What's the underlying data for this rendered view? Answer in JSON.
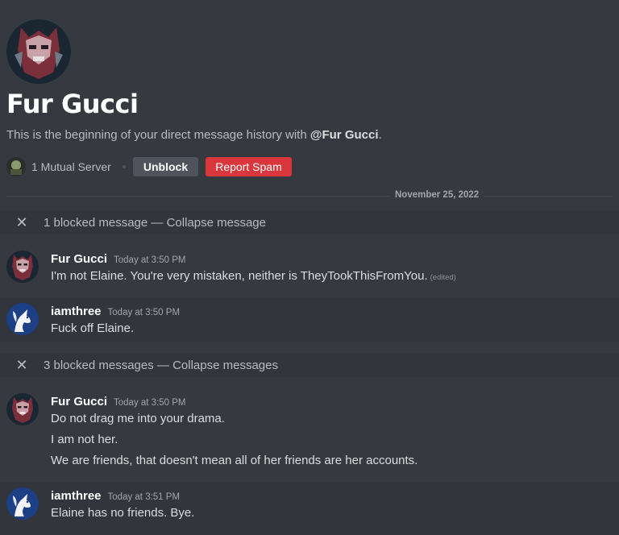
{
  "header": {
    "title": "Fur Gucci",
    "intro_prefix": "This is the beginning of your direct message history with ",
    "intro_mention": "@Fur Gucci",
    "intro_suffix": ".",
    "mutual_servers": "1 Mutual Server",
    "unblock_label": "Unblock",
    "report_spam_label": "Report Spam"
  },
  "date_divider": "November 25, 2022",
  "blocked_groups": [
    {
      "text": "1 blocked message — Collapse message",
      "icon": "close-icon"
    },
    {
      "text": "3 blocked messages — Collapse messages",
      "icon": "close-icon"
    }
  ],
  "messages": [
    {
      "author": "Fur Gucci",
      "timestamp": "Today at 3:50 PM",
      "lines": [
        "I'm not Elaine. You're very mistaken, neither is TheyTookThisFromYou."
      ],
      "edited": "(edited)"
    },
    {
      "author": "iamthree",
      "timestamp": "Today at 3:50 PM",
      "lines": [
        "Fuck off Elaine."
      ]
    },
    {
      "author": "Fur Gucci",
      "timestamp": "Today at 3:50 PM",
      "lines": [
        "Do not drag me into your drama.",
        "I am not her.",
        "We are friends, that doesn't mean all of her friends are her accounts."
      ]
    },
    {
      "author": "iamthree",
      "timestamp": "Today at 3:51 PM",
      "lines": [
        "Elaine has no friends.  Bye."
      ]
    }
  ],
  "colors": {
    "background": "#36393f",
    "blocked_bar": "#32353b",
    "unblock_button": "#4f545c",
    "report_spam_button": "#da373c"
  }
}
